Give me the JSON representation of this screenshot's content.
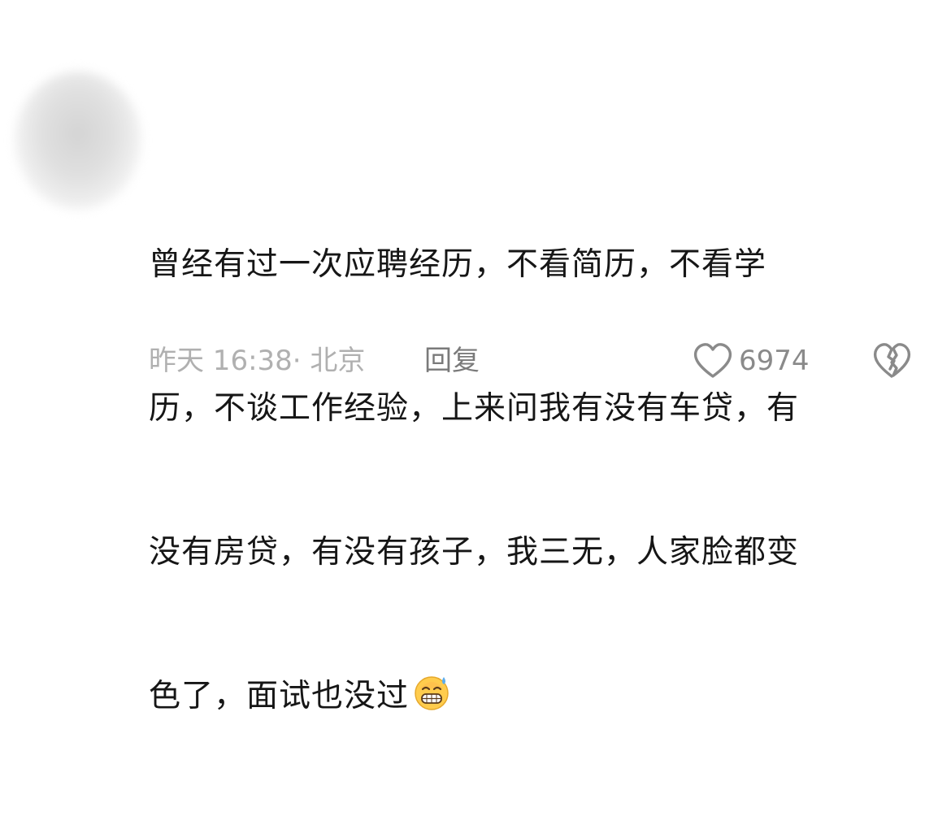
{
  "comment": {
    "lines": [
      "曾经有过一次应聘经历，不看简历，不看学",
      "历，不谈工作经验，上来问我有没有车贷，有",
      "没有房贷，有没有孩子，我三无，人家脸都变",
      "色了，面试也没过"
    ],
    "emoji": "grin-sweat-emoji",
    "time_location": "昨天 16:38· 北京",
    "reply_label": "回复",
    "like_count": "6974",
    "like_icon": "heart-outline-icon",
    "dislike_icon": "broken-heart-icon"
  }
}
